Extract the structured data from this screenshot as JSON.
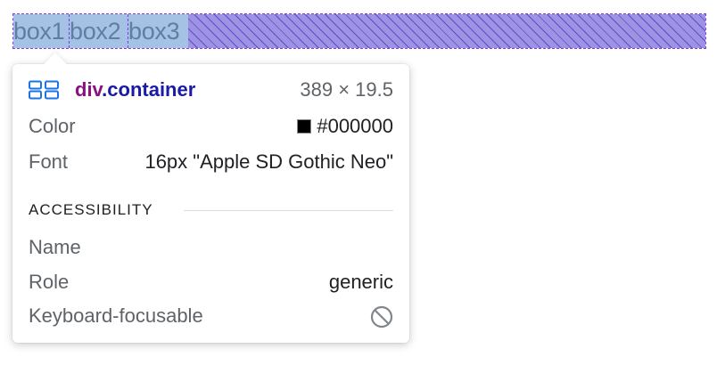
{
  "boxes": [
    {
      "label": "box1"
    },
    {
      "label": "box2"
    },
    {
      "label": "box3"
    }
  ],
  "tooltip": {
    "header": {
      "icon": "flex-layout-icon",
      "tag": "div",
      "class_name": ".container",
      "dimensions": "389 × 19.5"
    },
    "color": {
      "label": "Color",
      "value": "#000000",
      "swatch": "#000000"
    },
    "font": {
      "label": "Font",
      "value": "16px \"Apple SD Gothic Neo\""
    },
    "accessibility": {
      "title": "ACCESSIBILITY",
      "name_label": "Name",
      "name_value": "",
      "role_label": "Role",
      "role_value": "generic",
      "focusable_label": "Keyboard-focusable",
      "focusable_icon": "not-allowed-icon"
    }
  },
  "colors": {
    "tag": "#881280",
    "class": "#1a1aa6",
    "box_fill": "#a5c2e4",
    "box_text": "#5c7fa3",
    "flex_space": "#9d93e2",
    "outline": "#7b3fe4"
  }
}
